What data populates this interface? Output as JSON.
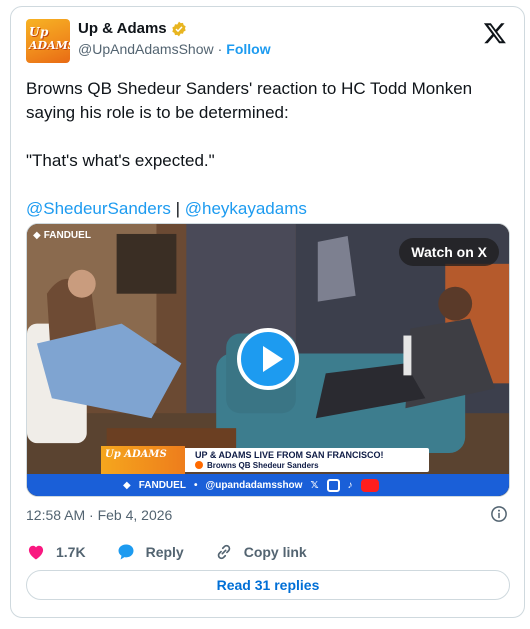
{
  "author": {
    "name": "Up & Adams",
    "handle": "@UpAndAdamsShow",
    "separator": "·",
    "follow_label": "Follow",
    "avatar_line1": "Up",
    "avatar_line2": "ADAMS"
  },
  "post": {
    "line1": "Browns QB Shedeur Sanders' reaction to HC Todd Monken saying his role is to be determined:",
    "quote": "\"That's what's expected.\"",
    "mention1": "@ShedeurSanders",
    "mention_sep": " | ",
    "mention2": "@heykayadams"
  },
  "media": {
    "watch_label": "Watch on X",
    "corner_tag": "FANDUEL",
    "lower_third_logo_l1": "Up",
    "lower_third_logo_l2": "ADAMS",
    "lower_third_title": "UP & ADAMS LIVE FROM SAN FRANCISCO!",
    "lower_third_sub": "Browns QB Shedeur Sanders",
    "ticker_brand": "FANDUEL",
    "ticker_dot": "•",
    "ticker_handle": "@upandadamsshow"
  },
  "meta": {
    "timestamp": "12:58 AM · Feb 4, 2026"
  },
  "actions": {
    "likes": "1.7K",
    "reply_label": "Reply",
    "copy_label": "Copy link"
  },
  "replies_button": "Read 31 replies",
  "colors": {
    "accent": "#1d9bf0",
    "like": "#f91880",
    "border": "#cfd9de",
    "secondary_text": "#536471"
  }
}
